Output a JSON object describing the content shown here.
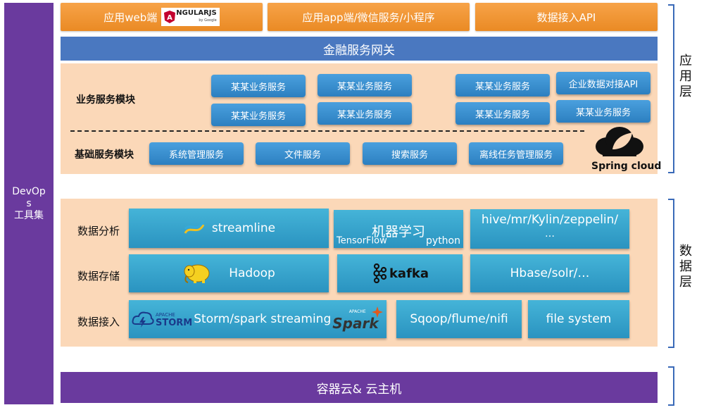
{
  "devops": {
    "chars": [
      "DevOp",
      "s",
      "工具集"
    ]
  },
  "top_row": {
    "web": {
      "label": "应用web端",
      "logo_text": "NGULARJS",
      "logo_sub": "by Google"
    },
    "app": {
      "label": "应用app端/微信服务/小程序"
    },
    "api": {
      "label": "数据接入API"
    }
  },
  "gateway": {
    "label": "金融服务网关"
  },
  "business": {
    "label": "业务服务模块",
    "services": [
      "某某业务服务",
      "某某业务服务",
      "某某业务服务",
      "企业数据对接API",
      "某某业务服务",
      "某某业务服务",
      "某某业务服务",
      "某某业务服务"
    ]
  },
  "foundation": {
    "label": "基础服务模块",
    "services": [
      "系统管理服务",
      "文件服务",
      "搜索服务",
      "离线任务管理服务"
    ]
  },
  "spring": {
    "label": "Spring cloud"
  },
  "analysis": {
    "label": "数据分析",
    "streamline": "streamline",
    "ml": {
      "title": "机器学习",
      "tf": "TensorFlow",
      "tm": "™",
      "py": "python"
    },
    "hive": {
      "line1": "hive/mr/Kylin/zeppelin/",
      "line2": "…"
    }
  },
  "storage": {
    "label": "数据存储",
    "hadoop": "Hadoop",
    "kafka": "kafka",
    "hbase": "Hbase/solr/…"
  },
  "ingest": {
    "label": "数据接入",
    "storm_small": "APACHE",
    "storm_logo": "STORM",
    "storm": "Storm/spark streaming",
    "spark_small": "APACHE",
    "spark_logo": "Spark",
    "sqoop": "Sqoop/flume/nifi",
    "fs": "file system"
  },
  "bottom": {
    "label": "容器云& 云主机"
  },
  "layers": {
    "app": [
      "应",
      "用",
      "层"
    ],
    "data": [
      "数",
      "据",
      "层"
    ]
  },
  "colors": {
    "purple": "#6a3a9e",
    "orange": "#f29a3a",
    "blue": "#4a78c0",
    "peach": "#fbd8b8",
    "teal": "#2a93c0"
  }
}
